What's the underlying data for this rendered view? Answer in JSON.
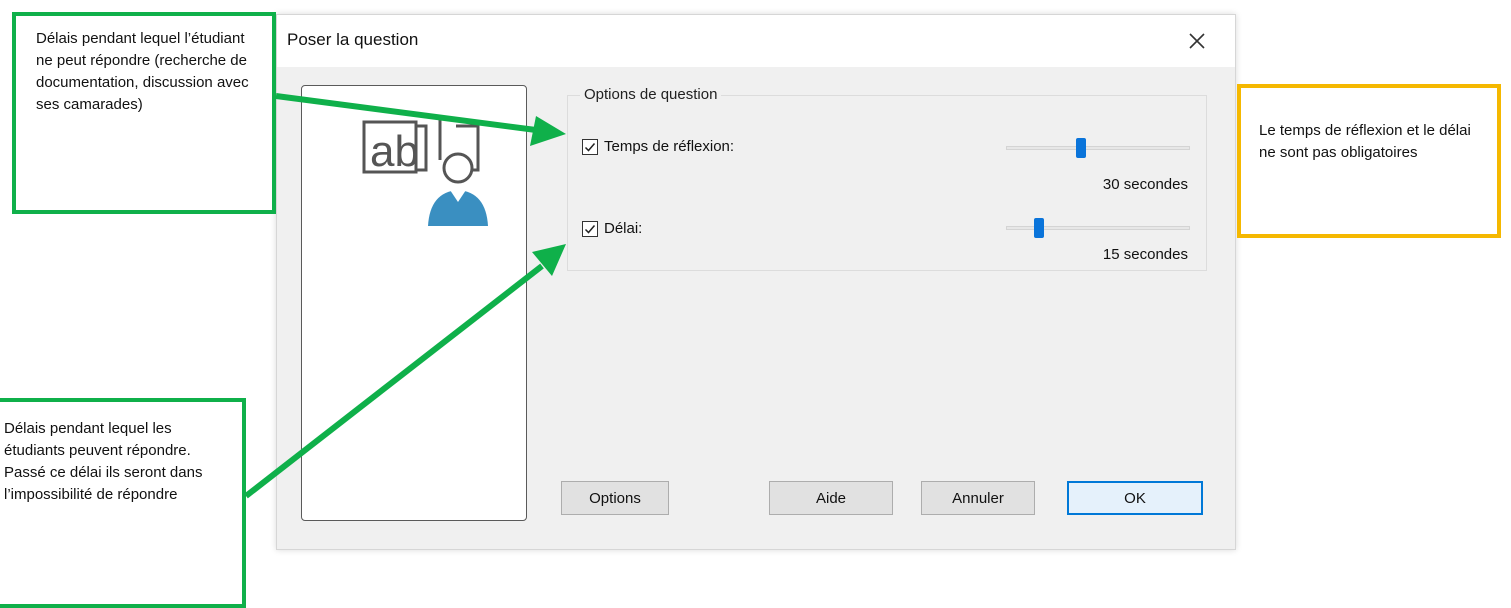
{
  "dialog": {
    "title": "Poser la question",
    "group_label": "Options de question",
    "options": [
      {
        "label": "Temps de réflexion:",
        "checked": true,
        "slider_fraction": 0.41,
        "value_text": "30 secondes"
      },
      {
        "label": "Délai:",
        "checked": true,
        "slider_fraction": 0.18,
        "value_text": "15 secondes"
      }
    ],
    "buttons": {
      "options": "Options",
      "help": "Aide",
      "cancel": "Annuler",
      "ok": "OK"
    },
    "icons": {
      "close": "close-icon",
      "illustration": "question-presenter-icon"
    },
    "colors": {
      "accent": "#0a74da",
      "illustration_blue": "#3a8fc1"
    }
  },
  "annotations": {
    "top_left": "Délais pendant lequel l’étudiant ne peut répondre (recherche de documentation, discussion avec ses camarades)",
    "bottom_left": "Délais pendant lequel les étudiants peuvent répondre. Passé ce délai ils seront dans l’impossibilité de répondre",
    "right": "Le temps de réflexion et le délai ne sont pas obligatoires",
    "colors": {
      "green": "#0fb04a",
      "yellow": "#f5b800"
    }
  }
}
